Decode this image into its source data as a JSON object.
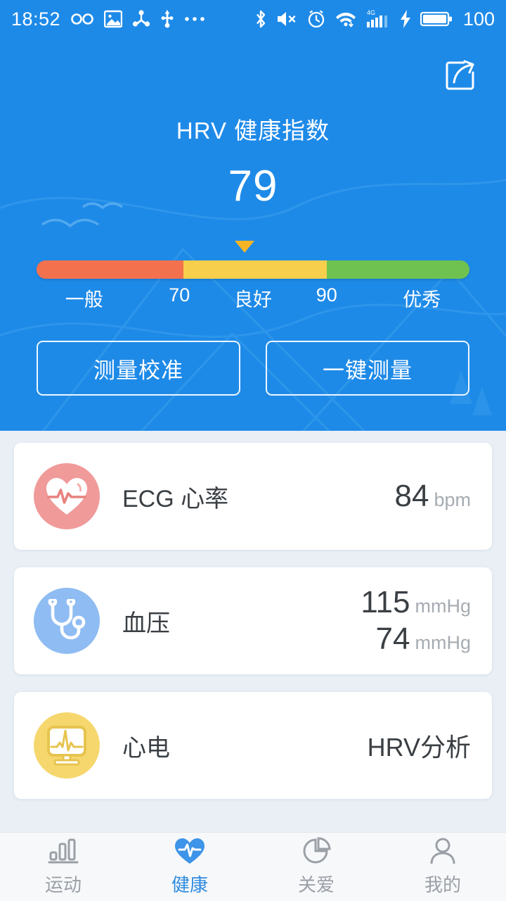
{
  "status_bar": {
    "time": "18:52",
    "battery_level": "100",
    "left_icons": [
      "infinity-icon",
      "image-icon",
      "share-node-icon",
      "usb-icon",
      "more-dots-icon"
    ],
    "right_icons": [
      "bluetooth-icon",
      "volume-mute-icon",
      "alarm-clock-icon",
      "wifi-icon",
      "signal-4g-icon",
      "charging-bolt-icon",
      "battery-icon"
    ],
    "network": "4G"
  },
  "hero": {
    "share_icon": "share-icon",
    "title": "HRV 健康指数",
    "score": "79",
    "gauge": {
      "marker_position_percent": 48,
      "segments": [
        {
          "label": "一般",
          "color": "#f4714e",
          "width_percent": 34
        },
        {
          "label": "良好",
          "color": "#f8cf4c",
          "width_percent": 33
        },
        {
          "label": "优秀",
          "color": "#6fc24f",
          "width_percent": 33
        }
      ],
      "labels": [
        {
          "text": "一般",
          "pos_percent": 11
        },
        {
          "text": "70",
          "pos_percent": 33
        },
        {
          "text": "良好",
          "pos_percent": 50
        },
        {
          "text": "90",
          "pos_percent": 67
        },
        {
          "text": "优秀",
          "pos_percent": 89
        }
      ]
    },
    "buttons": [
      {
        "label": "测量校准"
      },
      {
        "label": "一键测量"
      }
    ]
  },
  "cards": [
    {
      "icon": "heart-ecg-icon",
      "icon_bg": "#f09a9a",
      "label": "ECG 心率",
      "values": [
        {
          "number": "84",
          "unit": "bpm"
        }
      ]
    },
    {
      "icon": "stethoscope-icon",
      "icon_bg": "#8fbcf2",
      "label": "血压",
      "values": [
        {
          "number": "115",
          "unit": "mmHg"
        },
        {
          "number": "74",
          "unit": "mmHg"
        }
      ]
    },
    {
      "icon": "ecg-monitor-icon",
      "icon_bg": "#f5d76e",
      "label": "心电",
      "values": [
        {
          "text": "HRV分析"
        }
      ]
    }
  ],
  "tabbar": {
    "active_color": "#2f8ce0",
    "inactive_color": "#9aa0a6",
    "items": [
      {
        "icon": "bar-chart-icon",
        "label": "运动",
        "active": false
      },
      {
        "icon": "heart-pulse-icon",
        "label": "健康",
        "active": true
      },
      {
        "icon": "pie-chart-icon",
        "label": "关爱",
        "active": false
      },
      {
        "icon": "person-icon",
        "label": "我的",
        "active": false
      }
    ]
  }
}
